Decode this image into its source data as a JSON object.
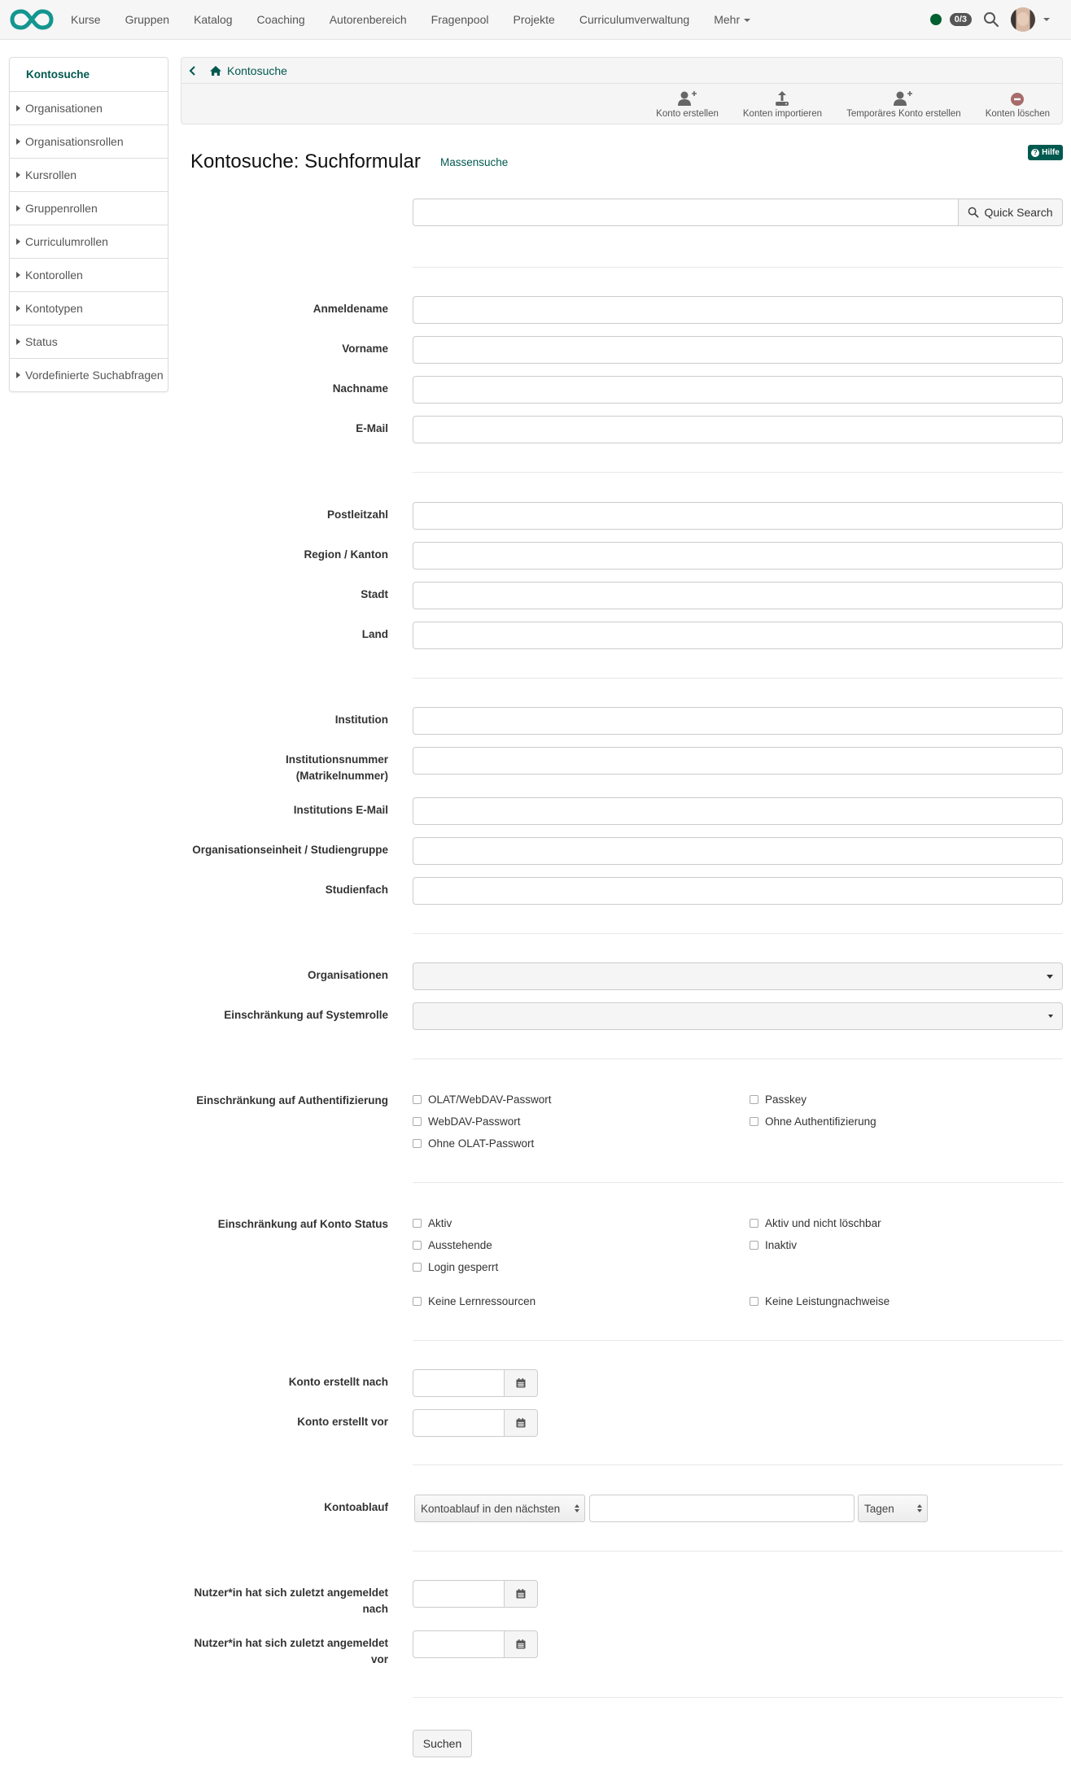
{
  "topnav": {
    "logo": "openolat-infinity-logo",
    "links": [
      "Kurse",
      "Gruppen",
      "Katalog",
      "Coaching",
      "Autorenbereich",
      "Fragenpool",
      "Projekte",
      "Curriculumverwaltung",
      "Mehr"
    ],
    "status_color": "#00602f",
    "counter": "0/3",
    "icons": {
      "search": "search-icon",
      "avatar": "user-avatar",
      "menu": "caret-down-icon"
    }
  },
  "sidebar": {
    "items": [
      {
        "label": "Kontosuche",
        "active": true
      },
      {
        "label": "Organisationen"
      },
      {
        "label": "Organisationsrollen"
      },
      {
        "label": "Kursrollen"
      },
      {
        "label": "Gruppenrollen"
      },
      {
        "label": "Curriculumrollen"
      },
      {
        "label": "Kontorollen"
      },
      {
        "label": "Kontotypen"
      },
      {
        "label": "Status"
      },
      {
        "label": "Vordefinierte Suchabfragen"
      }
    ]
  },
  "breadcrumb": {
    "current": "Kontosuche"
  },
  "toolbar": {
    "actions": [
      {
        "label": "Konto erstellen",
        "icon": "user-plus-icon"
      },
      {
        "label": "Konten importieren",
        "icon": "upload-icon"
      },
      {
        "label": "Temporäres Konto erstellen",
        "icon": "user-plus-icon"
      },
      {
        "label": "Konten löschen",
        "icon": "minus-circle-icon"
      }
    ]
  },
  "page": {
    "title": "Kontosuche: Suchformular",
    "mass_search_link": "Massensuche",
    "help_label": "Hilfe",
    "accent_color": "#00594f"
  },
  "form": {
    "quick_search": {
      "value": "",
      "button": "Quick Search"
    },
    "fields": {
      "login": {
        "label": "Anmeldename",
        "value": ""
      },
      "firstname": {
        "label": "Vorname",
        "value": ""
      },
      "lastname": {
        "label": "Nachname",
        "value": ""
      },
      "email": {
        "label": "E-Mail",
        "value": ""
      },
      "zipcode": {
        "label": "Postleitzahl",
        "value": ""
      },
      "region": {
        "label": "Region / Kanton",
        "value": ""
      },
      "city": {
        "label": "Stadt",
        "value": ""
      },
      "country": {
        "label": "Land",
        "value": ""
      },
      "institution": {
        "label": "Institution",
        "value": ""
      },
      "institution_number": {
        "label_line1": "Institutionsnummer",
        "label_line2": "(Matrikelnummer)",
        "value": ""
      },
      "institution_email": {
        "label": "Institutions E-Mail",
        "value": ""
      },
      "org_unit": {
        "label": "Organisationseinheit / Studiengruppe",
        "value": ""
      },
      "study_subject": {
        "label": "Studienfach",
        "value": ""
      }
    },
    "organisations": {
      "label": "Organisationen",
      "value": ""
    },
    "system_role": {
      "label": "Einschränkung auf Systemrolle",
      "value": ""
    },
    "authentication": {
      "label": "Einschränkung auf Authentifizierung",
      "options": [
        {
          "label": "OLAT/WebDAV-Passwort",
          "checked": false
        },
        {
          "label": "Passkey",
          "checked": false
        },
        {
          "label": "WebDAV-Passwort",
          "checked": false
        },
        {
          "label": "Ohne Authentifizierung",
          "checked": false
        },
        {
          "label": "Ohne OLAT-Passwort",
          "checked": false
        }
      ]
    },
    "account_status": {
      "label": "Einschränkung auf Konto Status",
      "options": [
        {
          "label": "Aktiv",
          "checked": false
        },
        {
          "label": "Aktiv und nicht löschbar",
          "checked": false
        },
        {
          "label": "Ausstehende",
          "checked": false
        },
        {
          "label": "Inaktiv",
          "checked": false
        },
        {
          "label": "Login gesperrt",
          "checked": false
        },
        {
          "label": "Keine Lernressourcen",
          "checked": false
        },
        {
          "label": "Keine Leistungnachweise",
          "checked": false
        }
      ]
    },
    "created_after": {
      "label": "Konto erstellt nach",
      "value": ""
    },
    "created_before": {
      "label": "Konto erstellt vor",
      "value": ""
    },
    "expiration": {
      "label": "Kontoablauf",
      "mode": "Kontoablauf in den nächsten",
      "amount": "",
      "unit": "Tagen"
    },
    "login_after": {
      "label_line1": "Nutzer*in hat sich zuletzt angemeldet",
      "label_line2": "nach",
      "value": ""
    },
    "login_before": {
      "label_line1": "Nutzer*in hat sich zuletzt angemeldet",
      "label_line2": "vor",
      "value": ""
    },
    "submit_label": "Suchen"
  }
}
